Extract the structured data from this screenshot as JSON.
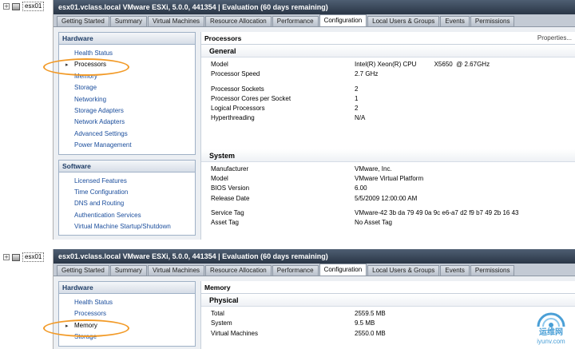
{
  "tree": {
    "host": "esx01",
    "expander": "+"
  },
  "window": {
    "title": "esx01.vclass.local VMware ESXi, 5.0.0, 441354 | Evaluation (60 days remaining)"
  },
  "tabs": [
    {
      "label": "Getting Started"
    },
    {
      "label": "Summary"
    },
    {
      "label": "Virtual Machines"
    },
    {
      "label": "Resource Allocation"
    },
    {
      "label": "Performance"
    },
    {
      "label": "Configuration",
      "active": true
    },
    {
      "label": "Local Users & Groups"
    },
    {
      "label": "Events"
    },
    {
      "label": "Permissions"
    }
  ],
  "nav": {
    "hardware_header": "Hardware",
    "hardware_items": [
      "Health Status",
      "Processors",
      "Memory",
      "Storage",
      "Networking",
      "Storage Adapters",
      "Network Adapters",
      "Advanced Settings",
      "Power Management"
    ],
    "software_header": "Software",
    "software_items": [
      "Licensed Features",
      "Time Configuration",
      "DNS and Routing",
      "Authentication Services",
      "Virtual Machine Startup/Shutdown"
    ]
  },
  "processors": {
    "title": "Processors",
    "properties_link": "Properties...",
    "general_title": "General",
    "model_label": "Model",
    "model_value": "Intel(R) Xeon(R) CPU          X5650  @ 2.67GHz",
    "speed_label": "Processor Speed",
    "speed_value": "2.7 GHz",
    "sockets_label": "Processor Sockets",
    "sockets_value": "2",
    "cores_label": "Processor Cores per Socket",
    "cores_value": "1",
    "logical_label": "Logical Processors",
    "logical_value": "2",
    "ht_label": "Hyperthreading",
    "ht_value": "N/A",
    "system_title": "System",
    "manufacturer_label": "Manufacturer",
    "manufacturer_value": "VMware, Inc.",
    "sys_model_label": "Model",
    "sys_model_value": "VMware Virtual Platform",
    "bios_label": "BIOS Version",
    "bios_value": "6.00",
    "release_label": "Release Date",
    "release_value": "5/5/2009 12:00:00 AM",
    "service_tag_label": "Service Tag",
    "service_tag_value": "VMware-42 3b da 79 49 0a 9c e6-a7 d2 f9 b7 49 2b 16 43",
    "asset_tag_label": "Asset Tag",
    "asset_tag_value": "No Asset Tag"
  },
  "memory": {
    "title": "Memory",
    "physical_title": "Physical",
    "total_label": "Total",
    "total_value": "2559.5 MB",
    "system_label": "System",
    "system_value": "9.5 MB",
    "vm_label": "Virtual Machines",
    "vm_value": "2550.0 MB"
  },
  "watermark": {
    "text": "运维网",
    "sub": "iyunv.com",
    "color": "#2b8fd0"
  },
  "colors": {
    "highlight": "#f29a27",
    "titlebar": "#2a3646",
    "link": "#1a4d9c"
  }
}
